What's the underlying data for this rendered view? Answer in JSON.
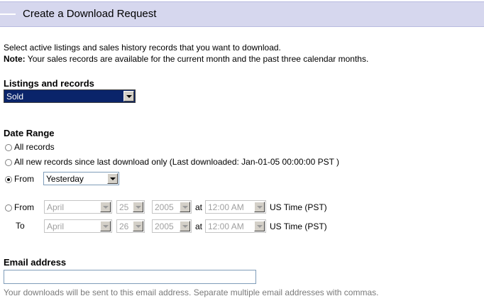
{
  "header": {
    "title": "Create a Download Request"
  },
  "intro": {
    "line1": "Select active listings and sales history records that you want to download.",
    "note_label": "Note:",
    "note_text": "Your sales records are available for the current month and the past three calendar months."
  },
  "listings": {
    "title": "Listings and records",
    "selected": "Sold"
  },
  "date_range": {
    "title": "Date Range",
    "option_all": "All records",
    "option_new": "All new records since last download only (Last downloaded: Jan-01-05 00:00:00 PST )",
    "option_from_label": "From",
    "from_preset": "Yesterday",
    "custom_from_label": "From",
    "custom_to_label": "To",
    "from": {
      "month": "April",
      "day": "25",
      "year": "2005",
      "time": "12:00 AM"
    },
    "to": {
      "month": "April",
      "day": "26",
      "year": "2005",
      "time": "12:00 AM"
    },
    "at_label": "at",
    "timezone": "US Time (PST)",
    "selected_option": "from-preset"
  },
  "email": {
    "title": "Email address",
    "value": "",
    "hint": "Your downloads will be sent to this email address. Separate multiple email addresses with commas."
  }
}
